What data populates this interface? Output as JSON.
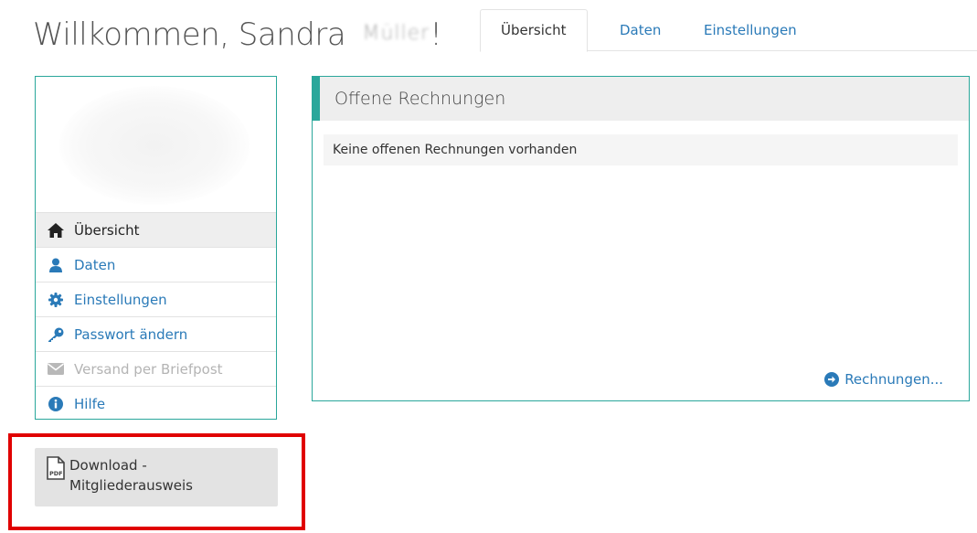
{
  "header": {
    "greeting": "Willkommen, Sandra",
    "name_tail": "!",
    "redacted_text": "Müller"
  },
  "tabs": [
    {
      "label": "Übersicht"
    },
    {
      "label": "Daten"
    },
    {
      "label": "Einstellungen"
    }
  ],
  "sidebar": {
    "items": [
      {
        "label": "Übersicht",
        "icon": "home-icon"
      },
      {
        "label": "Daten",
        "icon": "user-icon"
      },
      {
        "label": "Einstellungen",
        "icon": "gear-icon"
      },
      {
        "label": "Passwort ändern",
        "icon": "key-icon"
      },
      {
        "label": "Versand per Briefpost",
        "icon": "envelope-icon"
      },
      {
        "label": "Hilfe",
        "icon": "info-icon"
      }
    ]
  },
  "download": {
    "label": "Download - Mitgliederausweis",
    "icon": "pdf-file-icon"
  },
  "panel": {
    "title": "Offene Rechnungen",
    "message": "Keine offenen Rechnungen vorhanden",
    "link_label": "Rechnungen...",
    "link_icon": "arrow-circle-right-icon"
  },
  "colors": {
    "accent": "#2aa79b",
    "link": "#2a7ab8",
    "highlight": "#e00000"
  }
}
